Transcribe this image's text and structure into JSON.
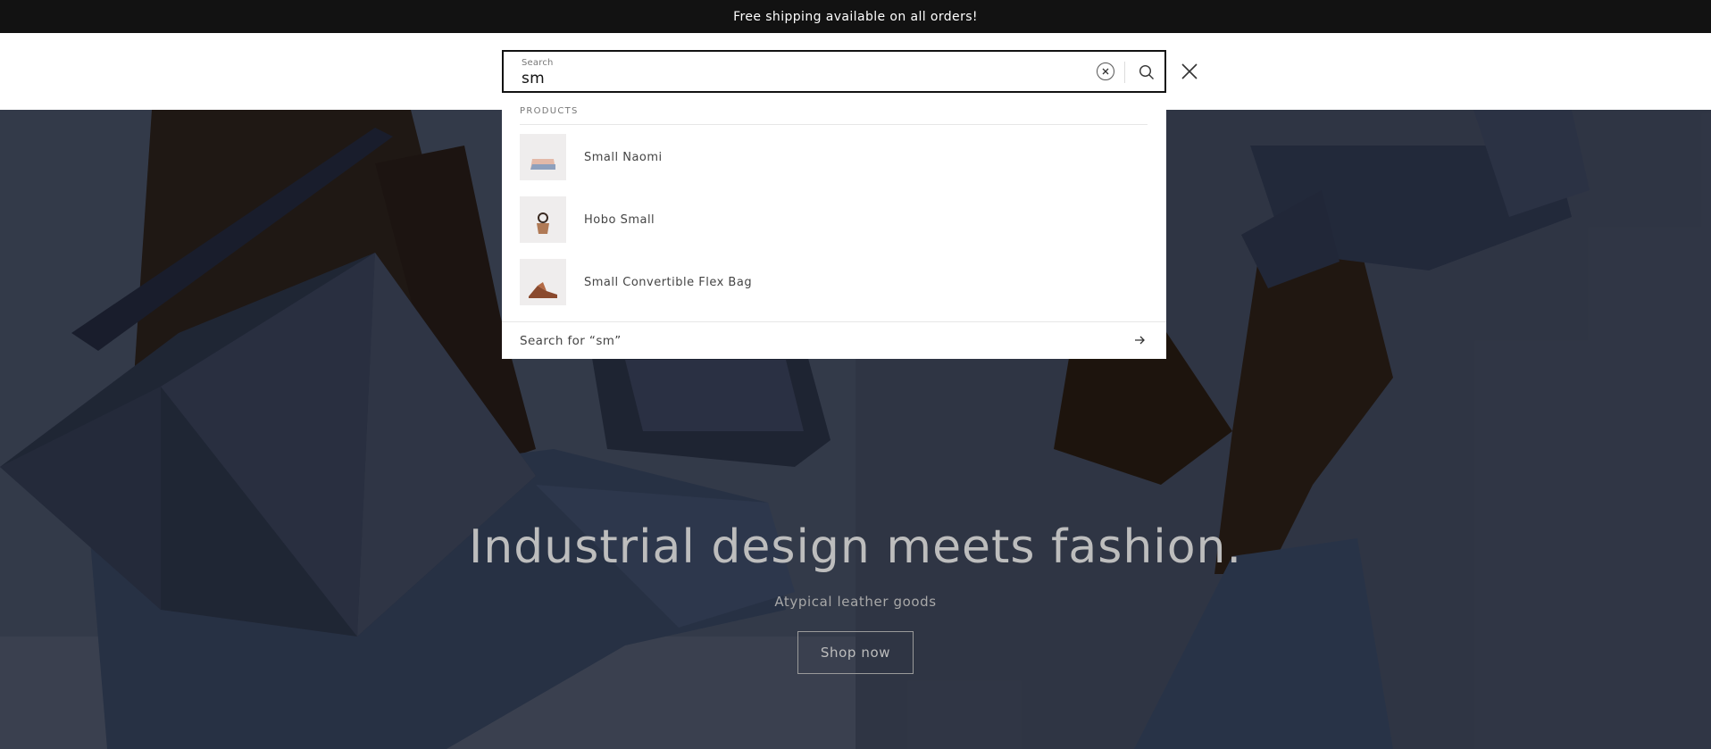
{
  "announcement": {
    "text": "Free shipping available on all orders!"
  },
  "search": {
    "label": "Search",
    "value": "sm",
    "clear_icon": "clear-circle-icon",
    "submit_icon": "search-icon",
    "close_icon": "close-icon"
  },
  "predictive": {
    "heading": "PRODUCTS",
    "products": [
      {
        "name": "Small Naomi"
      },
      {
        "name": "Hobo Small"
      },
      {
        "name": "Small Convertible Flex Bag"
      }
    ],
    "footer_text": "Search for “sm”",
    "footer_icon": "arrow-right-icon"
  },
  "hero": {
    "title": "Industrial design meets fashion.",
    "subtitle": "Atypical leather goods",
    "button_label": "Shop now"
  }
}
